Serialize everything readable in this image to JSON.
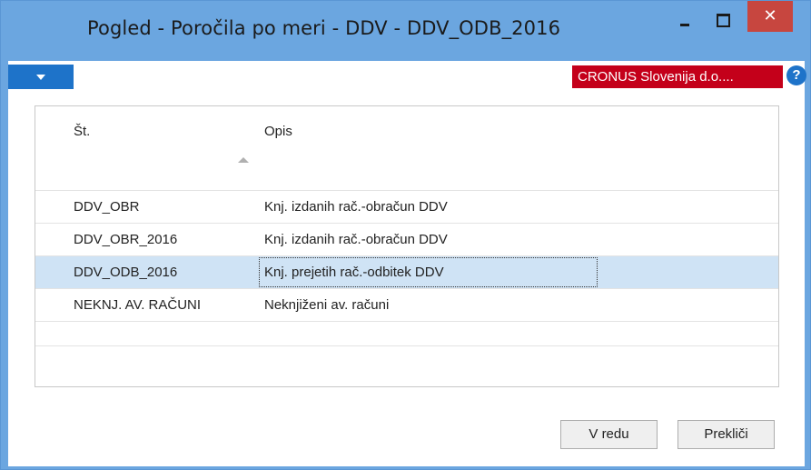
{
  "window": {
    "title": "Pogled - Poročila po meri - DDV - DDV_ODB_2016",
    "close_glyph": "✕"
  },
  "actionbar": {
    "company": "CRONUS Slovenija d.o....",
    "help_glyph": "?"
  },
  "grid": {
    "columns": [
      "Št.",
      "Opis"
    ],
    "sort_column": "Št.",
    "sort_direction": "ascending",
    "rows": [
      {
        "no": "DDV_OBR",
        "opis": "Knj. izdanih rač.-obračun DDV"
      },
      {
        "no": "DDV_OBR_2016",
        "opis": "Knj. izdanih rač.-obračun DDV"
      },
      {
        "no": "DDV_ODB_2016",
        "opis": "Knj. prejetih rač.-odbitek DDV"
      },
      {
        "no": "NEKNJ. AV. RAČUNI",
        "opis": "Neknjiženi av. računi"
      }
    ],
    "selected_row": 2
  },
  "buttons": {
    "ok": "V redu",
    "cancel": "Prekliči"
  },
  "colors": {
    "titlebar": "#6ba6e0",
    "close": "#c7463f",
    "company_badge": "#c4001a",
    "accent": "#1e73c9",
    "selection": "#cfe3f5"
  }
}
